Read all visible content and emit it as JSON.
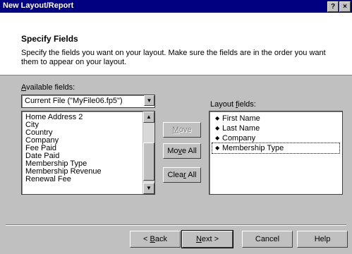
{
  "window": {
    "title": "New Layout/Report",
    "help_glyph": "?",
    "close_glyph": "×"
  },
  "header": {
    "title": "Specify Fields",
    "description": "Specify the fields you want on your layout. Make sure the fields are in the order you want them to appear on your layout."
  },
  "available": {
    "label_pre": "",
    "label_mn": "A",
    "label_post": "vailable fields:",
    "source": "Current File (\"MyFile06.fp5\")",
    "items": [
      "Home Address 2",
      "City",
      "Country",
      "Company",
      "Fee Paid",
      "Date Paid",
      "Membership Type",
      "Membership Revenue",
      "Renewal Fee"
    ]
  },
  "buttons": {
    "move_pre": "",
    "move_mn": "M",
    "move_post": "ove",
    "move_all_pre": "Mo",
    "move_all_mn": "v",
    "move_all_post": "e All",
    "clear_all_pre": "Clea",
    "clear_all_mn": "r",
    "clear_all_post": " All"
  },
  "layout": {
    "label_pre": "Layout ",
    "label_mn": "f",
    "label_post": "ields:",
    "items": [
      "First Name",
      "Last Name",
      "Company",
      "Membership Type"
    ],
    "selected_index": 3
  },
  "footer": {
    "back_pre": "< ",
    "back_mn": "B",
    "back_post": "ack",
    "next_pre": "",
    "next_mn": "N",
    "next_post": "ext >",
    "cancel": "Cancel",
    "help": "Help"
  },
  "glyphs": {
    "bullet": "◆",
    "arrow_up": "▲",
    "arrow_down": "▼"
  }
}
